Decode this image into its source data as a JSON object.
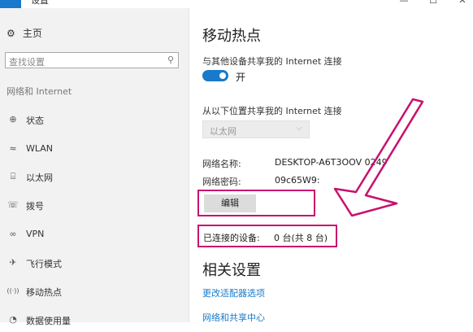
{
  "titlebar": {
    "back_label": "←",
    "title": "设置",
    "minimize": "—",
    "maximize": "☐",
    "close": "✕"
  },
  "sidebar": {
    "home": {
      "icon": "gear-icon",
      "icon_glyph": "⚙",
      "label": "主页"
    },
    "search": {
      "placeholder": "查找设置",
      "icon": "search-icon",
      "icon_glyph": "⚲"
    },
    "section_label": "网络和 Internet",
    "items": [
      {
        "icon": "globe-icon",
        "icon_glyph": "⊕",
        "label": "状态"
      },
      {
        "icon": "wifi-icon",
        "icon_glyph": "≈",
        "label": "WLAN"
      },
      {
        "icon": "ethernet-icon",
        "icon_glyph": "⌸",
        "label": "以太网"
      },
      {
        "icon": "dialup-icon",
        "icon_glyph": "☏",
        "label": "拨号"
      },
      {
        "icon": "vpn-icon",
        "icon_glyph": "∞",
        "label": "VPN"
      },
      {
        "icon": "airplane-icon",
        "icon_glyph": "✈",
        "label": "飞行模式"
      },
      {
        "icon": "hotspot-icon",
        "icon_glyph": "((·))",
        "label": "移动热点"
      },
      {
        "icon": "data-usage-icon",
        "icon_glyph": "◔",
        "label": "数据使用量"
      }
    ],
    "active_index": 6
  },
  "main": {
    "title": "移动热点",
    "share_label": "与其他设备共享我的 Internet 连接",
    "toggle": {
      "state": "on",
      "label": "开"
    },
    "from_label": "从以下位置共享我的 Internet 连接",
    "source_select": {
      "value": "以太网"
    },
    "network_name": {
      "key": "网络名称:",
      "value": "DESKTOP-A6T3OOV 0249"
    },
    "network_password": {
      "key": "网络密码:",
      "value": "09c65W9:"
    },
    "edit_button": "编辑",
    "connected": {
      "key": "已连接的设备:",
      "value": "0 台(共 8 台)"
    },
    "related_title": "相关设置",
    "links": [
      "更改适配器选项",
      "网络和共享中心"
    ]
  },
  "annotation": {
    "color": "#c8106e"
  }
}
